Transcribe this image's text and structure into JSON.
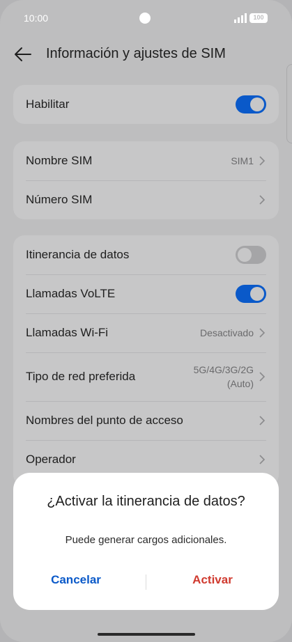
{
  "status": {
    "time": "10:00",
    "battery": "100"
  },
  "header": {
    "title": "Información y ajustes de SIM"
  },
  "card1": {
    "habilitar": {
      "label": "Habilitar",
      "state": "on"
    }
  },
  "card2": {
    "nombre": {
      "label": "Nombre SIM",
      "value": "SIM1"
    },
    "numero": {
      "label": "Número SIM"
    }
  },
  "card3": {
    "itinerancia": {
      "label": "Itinerancia de datos",
      "state": "off"
    },
    "volte": {
      "label": "Llamadas VoLTE",
      "state": "on"
    },
    "wifi": {
      "label": "Llamadas Wi-Fi",
      "value": "Desactivado"
    },
    "red": {
      "label": "Tipo de red preferida",
      "value_line1": "5G/4G/3G/2G",
      "value_line2": "(Auto)"
    },
    "apn": {
      "label": "Nombres del punto de acceso"
    },
    "operador": {
      "label": "Operador"
    }
  },
  "dialog": {
    "title": "¿Activar la itinerancia de datos?",
    "message": "Puede generar cargos adicionales.",
    "cancel": "Cancelar",
    "confirm": "Activar"
  },
  "colors": {
    "accent": "#0a59c9",
    "danger": "#d03a2f"
  }
}
